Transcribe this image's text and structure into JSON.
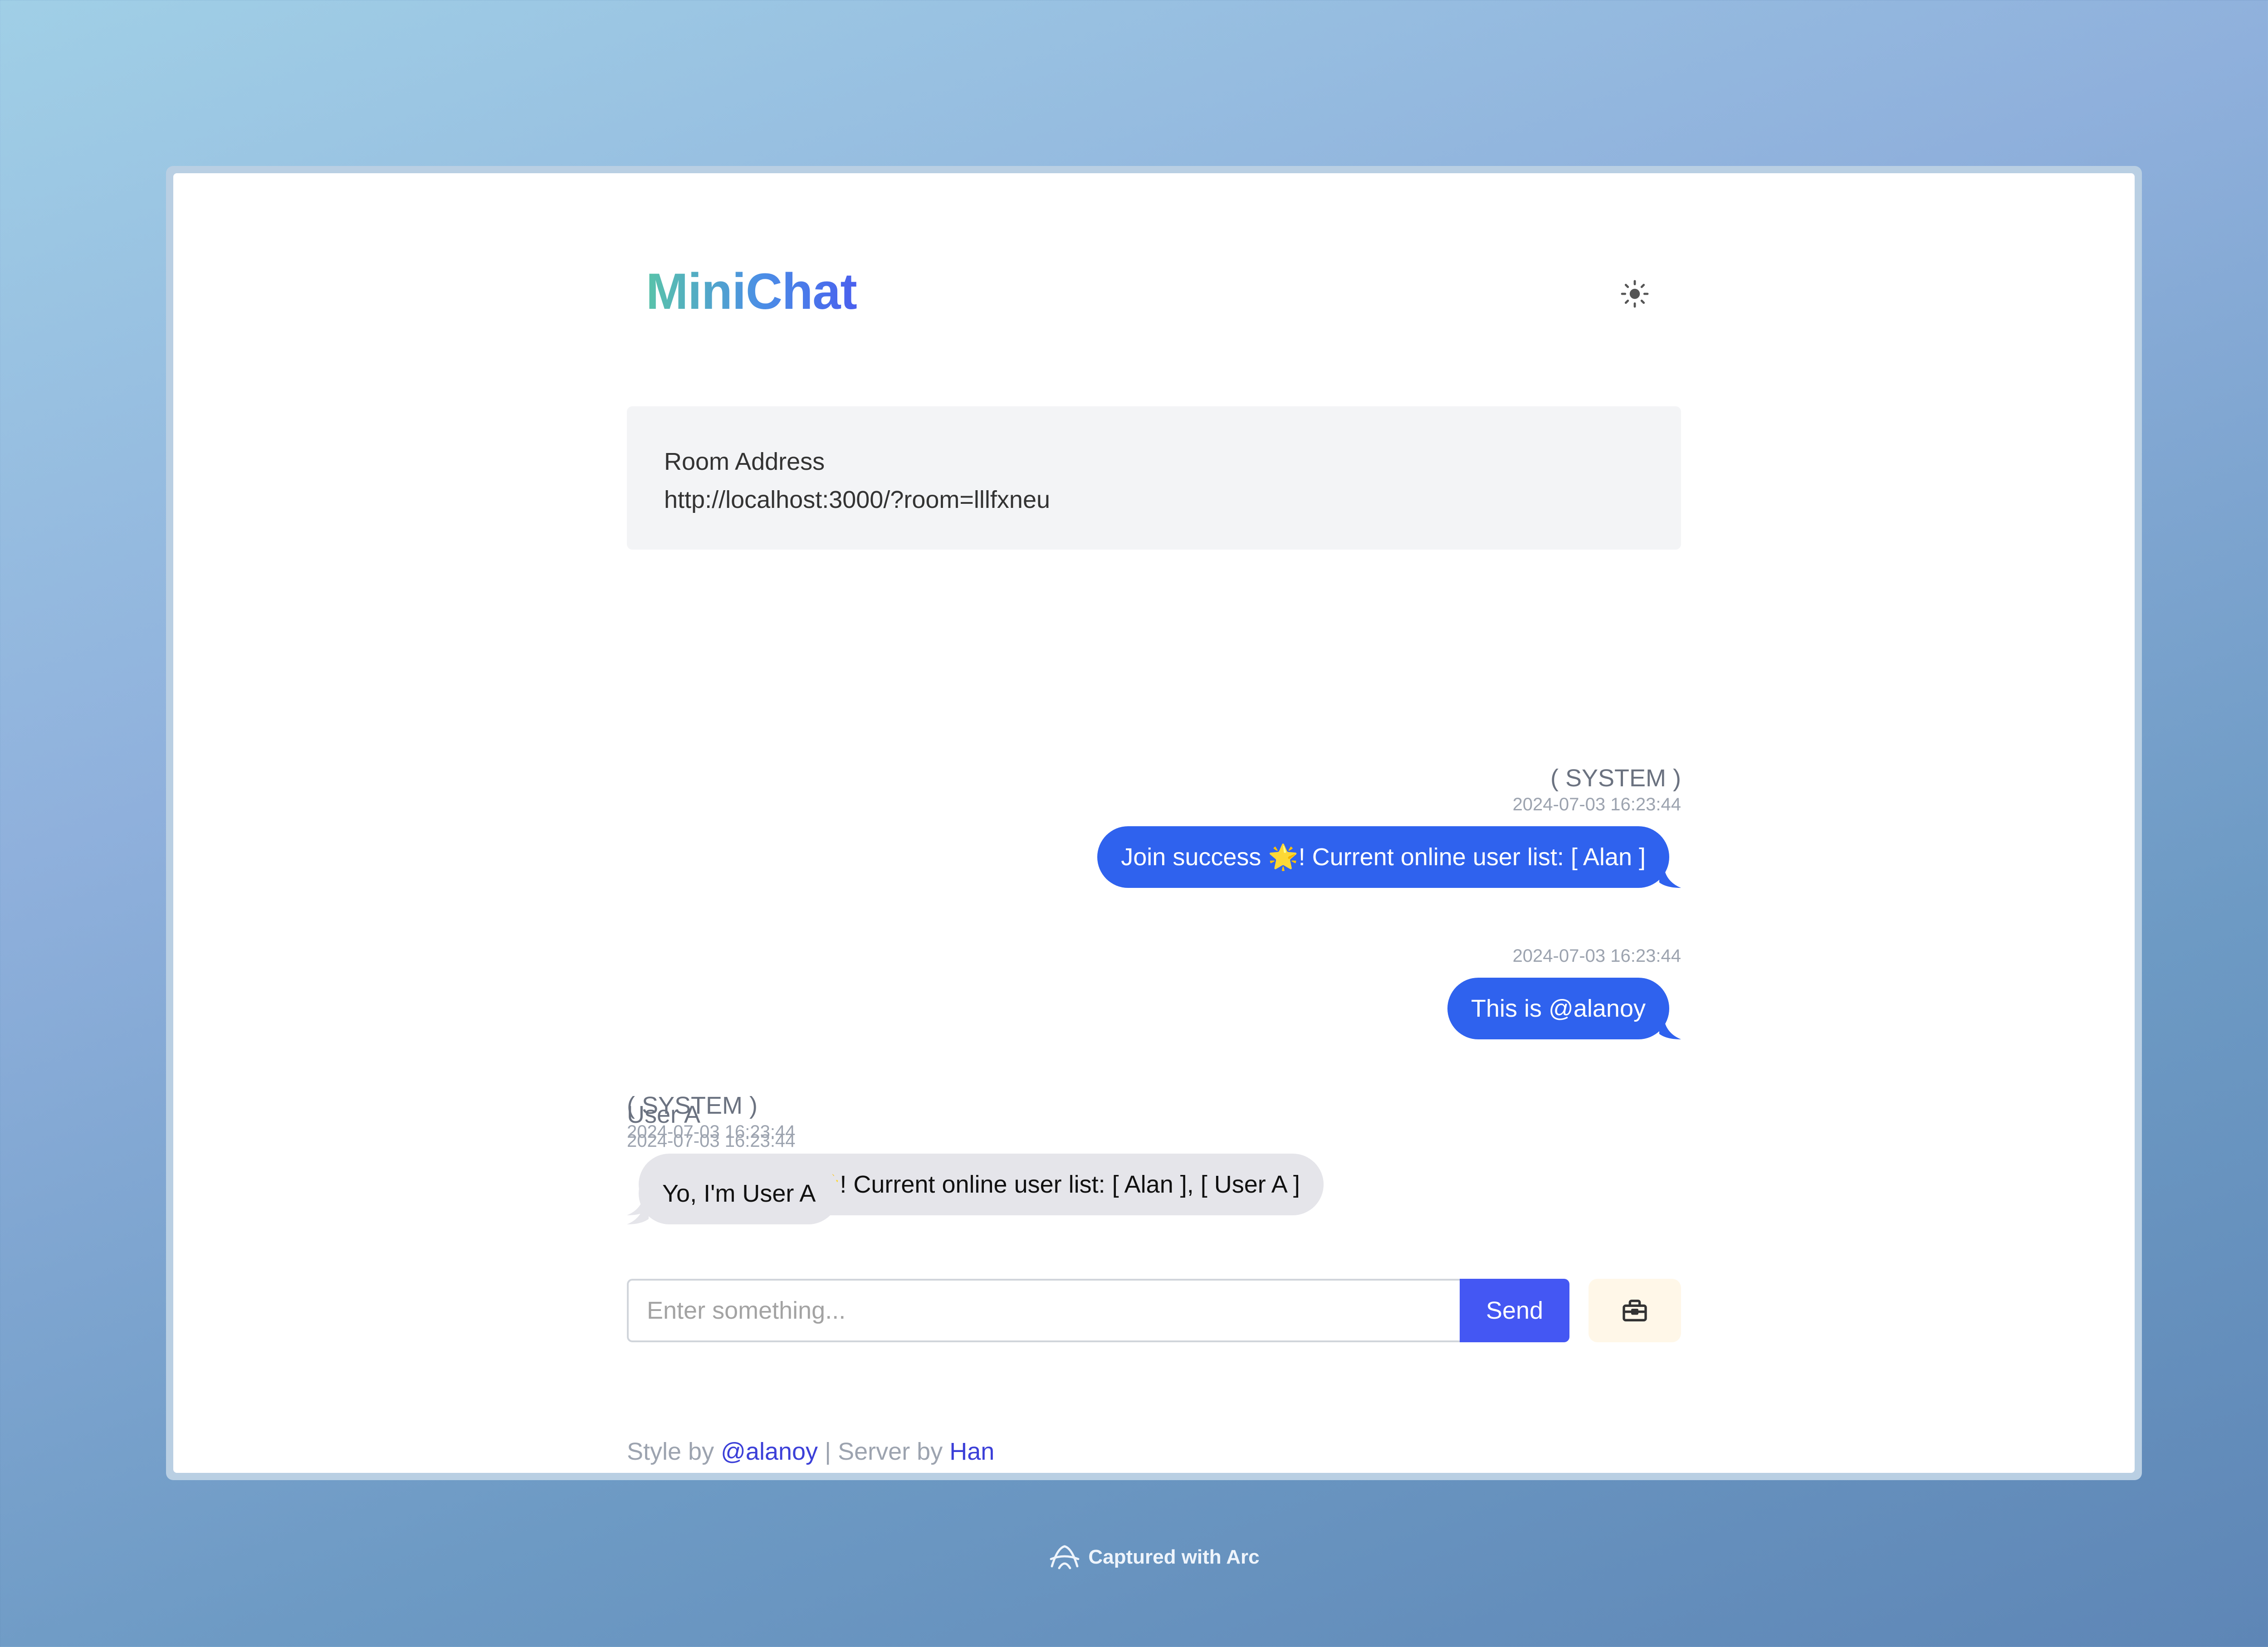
{
  "app": {
    "title": "MiniChat"
  },
  "room": {
    "label": "Room Address",
    "url": "http://localhost:3000/?room=lllfxneu"
  },
  "messages": [
    {
      "sender": "( SYSTEM )",
      "time": "2024-07-03 16:23:44",
      "text": "Join success 🌟! Current online user list: [ Alan ]",
      "side": "right"
    },
    {
      "sender": "",
      "time": "2024-07-03 16:23:44",
      "text": "This is @alanoy",
      "side": "right"
    },
    {
      "sender": "( SYSTEM )",
      "time": "2024-07-03 16:23:44",
      "text": "Join success 🌟! Current online user list: [ Alan ], [ User A ]",
      "side": "left"
    },
    {
      "sender": "User A",
      "time": "2024-07-03 16:23:44",
      "text": "Yo, I'm User A",
      "side": "left"
    }
  ],
  "composer": {
    "placeholder": "Enter something...",
    "value": "",
    "send_label": "Send"
  },
  "footer": {
    "style_prefix": "Style by",
    "style_author": "@alanoy",
    "separator": "|",
    "server_prefix": "Server by",
    "server_author": "Han"
  },
  "capture": {
    "label": "Captured with Arc"
  },
  "icons": {
    "theme": "sun-icon",
    "tools": "toolbox-icon",
    "arc": "arc-logo-icon"
  },
  "colors": {
    "outgoing_bubble": "#2f62ee",
    "incoming_bubble": "#e5e5ea",
    "send_button": "#4457f3",
    "link": "#3b3fd8"
  }
}
